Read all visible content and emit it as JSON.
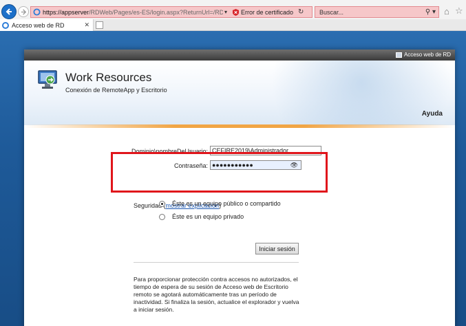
{
  "browser": {
    "url_host": "https://appserver",
    "url_rest": "/RDWeb/Pages/es-ES/login.aspx?ReturnUrl=/RDWeb/Pag",
    "cert_error": "Error de certificado",
    "search_placeholder": "Buscar...",
    "tab_title": "Acceso web de RD"
  },
  "header": {
    "top_link": "Acceso web de RD",
    "title": "Work Resources",
    "subtitle": "Conexión de RemoteApp y Escritorio",
    "help": "Ayuda"
  },
  "form": {
    "domain_label": "Dominio\\nombreDeUsuario:",
    "domain_value": "CEFIRE2019\\Administrador",
    "password_label": "Contraseña:",
    "password_value": "●●●●●●●●●●●",
    "security_label": "Seguridad (",
    "security_link": "mostrar explicación",
    "security_close": ")",
    "option_public": "Éste es un equipo público o compartido",
    "option_private": "Éste es un equipo privado",
    "selected_option": "public",
    "login_button": "Iniciar sesión",
    "info_text": "Para proporcionar protección contra accesos no autorizados, el tiempo de espera de su sesión de Acceso web de Escritorio remoto se agotará automáticamente tras un período de inactividad. Si finaliza la sesión, actualice el explorador y vuelva a iniciar sesión."
  },
  "colors": {
    "address_error_bg": "#f6c7c9",
    "highlight_box": "#e0151b",
    "accent_line": "#f1a545",
    "background": "#1f5d96"
  }
}
